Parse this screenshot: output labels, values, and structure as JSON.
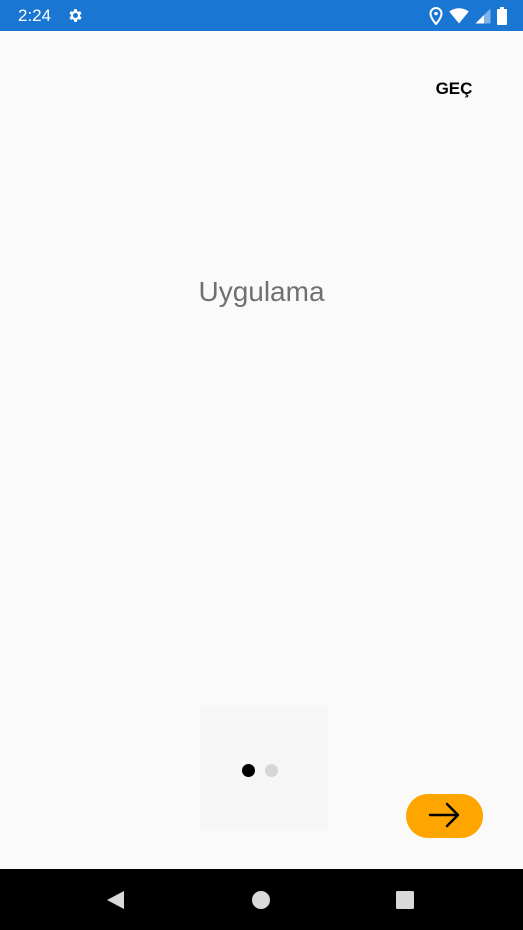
{
  "status_bar": {
    "time": "2:24",
    "background": "#1976d2",
    "icons": [
      "settings-icon",
      "location-icon",
      "wifi-icon",
      "cell-signal-icon",
      "battery-icon"
    ]
  },
  "onboarding": {
    "skip_label": "GEÇ",
    "title": "Uygulama",
    "page_count": 2,
    "active_page": 1,
    "next_icon": "arrow-right-icon",
    "accent_color": "#ffa500",
    "title_color": "#707070"
  },
  "nav_bar": {
    "icons": [
      "back-icon",
      "home-icon",
      "recents-icon"
    ]
  }
}
